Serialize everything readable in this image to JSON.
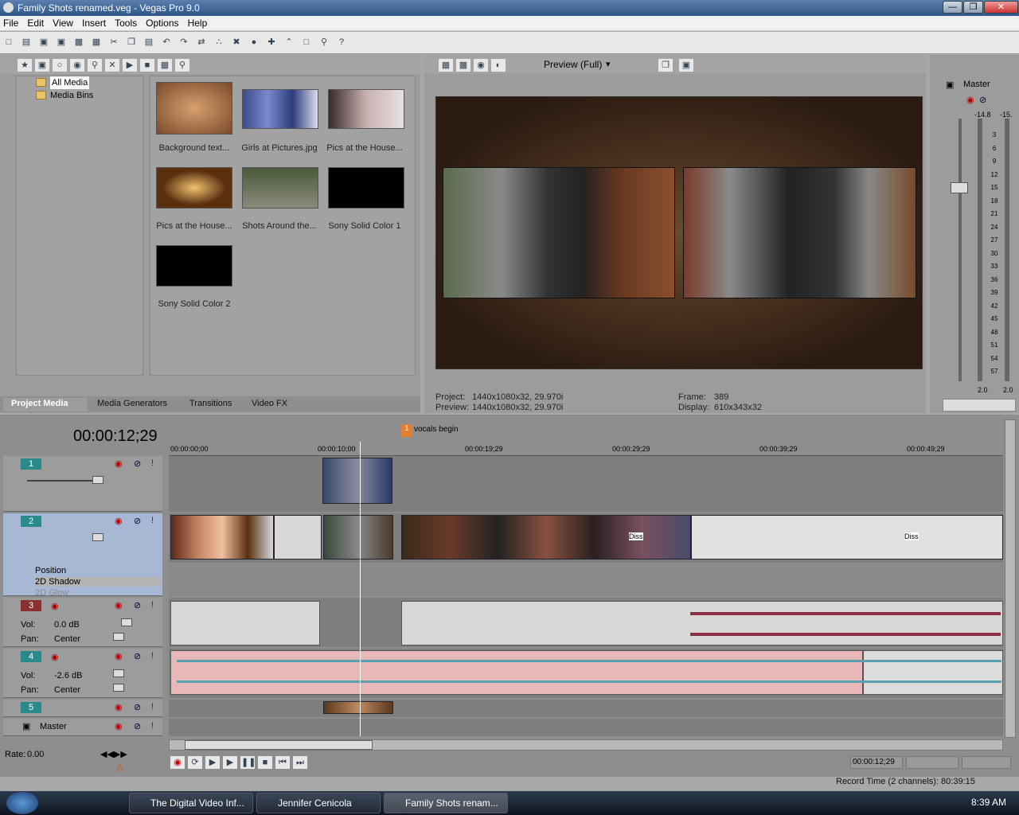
{
  "window": {
    "title": "Family Shots renamed.veg - Vegas Pro 9.0"
  },
  "menu": [
    "File",
    "Edit",
    "View",
    "Insert",
    "Tools",
    "Options",
    "Help"
  ],
  "explorer": {
    "tree": [
      "All Media",
      "Media Bins"
    ],
    "media": [
      {
        "label": "Background text..."
      },
      {
        "label": "Girls at Pictures.jpg"
      },
      {
        "label": "Pics at the House..."
      },
      {
        "label": "Pics at the House..."
      },
      {
        "label": "Shots Around the..."
      },
      {
        "label": "Sony Solid Color 1"
      },
      {
        "label": "Sony Solid Color 2"
      }
    ],
    "tabs": [
      "Project Media",
      "Media Generators",
      "Transitions",
      "Video FX"
    ]
  },
  "preview": {
    "mode": "Preview (Full)",
    "project_label": "Project:",
    "project": "1440x1080x32, 29.970i",
    "preview_label": "Preview:",
    "preview": "1440x1080x32, 29.970i",
    "frame_label": "Frame:",
    "frame": "389",
    "display_label": "Display:",
    "display": "610x343x32"
  },
  "mixer": {
    "label": "Master",
    "peak_left": "-14.8",
    "peak_right": "-15.",
    "scale": [
      "3",
      "6",
      "9",
      "12",
      "15",
      "18",
      "21",
      "24",
      "27",
      "30",
      "33",
      "36",
      "39",
      "42",
      "45",
      "48",
      "51",
      "54",
      "57"
    ],
    "bottom_left": "2.0",
    "bottom_right": "2.0"
  },
  "timeline": {
    "timecode": "00:00:12;29",
    "marker": "vocals begin",
    "marker_num": "1",
    "ruler": [
      "00:00:00;00",
      "00:00:10;00",
      "00:00:19;29",
      "00:00:29;29",
      "00:00:39;29",
      "00:00:49;29"
    ],
    "tracks": [
      {
        "num": "1"
      },
      {
        "num": "2",
        "env": [
          "Position",
          "2D Shadow",
          "2D Glow"
        ]
      },
      {
        "num": "3",
        "vol_label": "Vol:",
        "vol": "0.0 dB",
        "pan_label": "Pan:",
        "pan": "Center"
      },
      {
        "num": "4",
        "vol_label": "Vol:",
        "vol": "-2.6 dB",
        "pan_label": "Pan:",
        "pan": "Center"
      },
      {
        "num": "5"
      }
    ],
    "master": "Master",
    "dissolve": "Diss",
    "rate_label": "Rate:",
    "rate": "0.00",
    "cursor_time": "00:00:12;29"
  },
  "status": {
    "record_time": "Record Time (2 channels): 80:39:15"
  },
  "taskbar": {
    "tasks": [
      "The Digital Video Inf...",
      "Jennifer Cenicola",
      "Family Shots renam..."
    ],
    "clock": "8:39 AM"
  },
  "colors": {
    "accent": "#2a8a8a",
    "audio_clip": "#e8b8b8",
    "selected_track": "#a6b8d4"
  }
}
